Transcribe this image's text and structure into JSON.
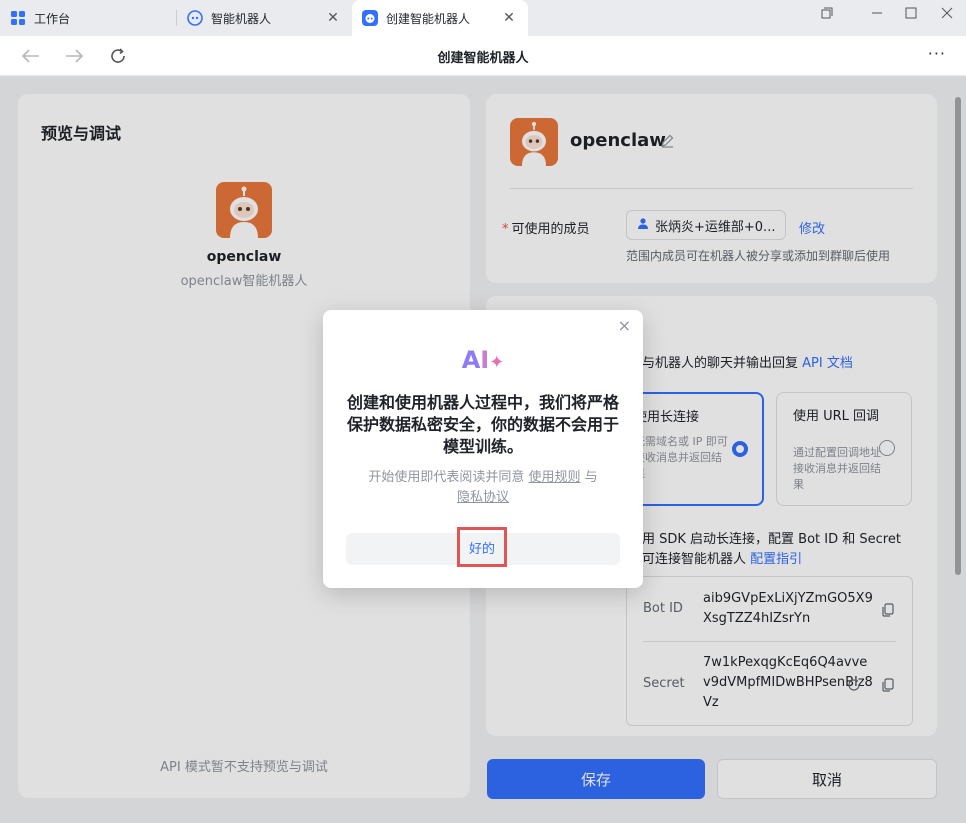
{
  "window": {
    "tabs": [
      {
        "label": "工作台"
      },
      {
        "label": "智能机器人"
      },
      {
        "label": "创建智能机器人"
      }
    ]
  },
  "nav": {
    "title": "创建智能机器人",
    "more": "···"
  },
  "left_panel": {
    "title": "预览与调试",
    "bot_name": "openclaw",
    "bot_subtitle": "openclaw智能机器人",
    "footer_note": "API 模式暂不支持预览与调试"
  },
  "bot_info": {
    "name": "openclaw",
    "members_label": "可使用的成员",
    "members_value": "张炳炎+运维部+0...",
    "modify": "修改",
    "members_hint": "范围内成员可在机器人被分享或添加到群聊后使用"
  },
  "connection": {
    "desc_text": "与机器人的聊天并输出回复",
    "api_doc": "API 文档",
    "option_long": {
      "title": "使用长连接",
      "desc": "无需域名或 IP 即可接收消息并返回结果"
    },
    "option_url": {
      "title": "使用 URL 回调",
      "desc": "通过配置回调地址接收消息并返回结果"
    },
    "sdk_line1": "用 SDK 启动长连接，配置 Bot ID 和 Secret",
    "sdk_line2": "可连接智能机器人",
    "config_guide": "配置指引",
    "bot_id_label": "Bot ID",
    "bot_id_value": "aib9GVpExLiXjYZmGO5X9XsgTZZ4hIZsrYn",
    "secret_label": "Secret",
    "secret_value": "7w1kPexqgKcEq6Q4avvev9dVMpfMIDwBHPsenBlz8Vz"
  },
  "buttons": {
    "save": "保存",
    "cancel": "取消"
  },
  "dialog": {
    "title": "创建和使用机器人过程中，我们将严格保护数据私密安全，你的数据不会用于模型训练。",
    "note_prefix": "开始使用即代表阅读并同意",
    "rules_link": "使用规则",
    "and": "与",
    "privacy_link": "隐私协议",
    "ok": "好的",
    "close": "×"
  },
  "colors": {
    "accent": "#3370ff",
    "bot_avatar": "#e8773b",
    "highlight_border": "#e05656"
  }
}
